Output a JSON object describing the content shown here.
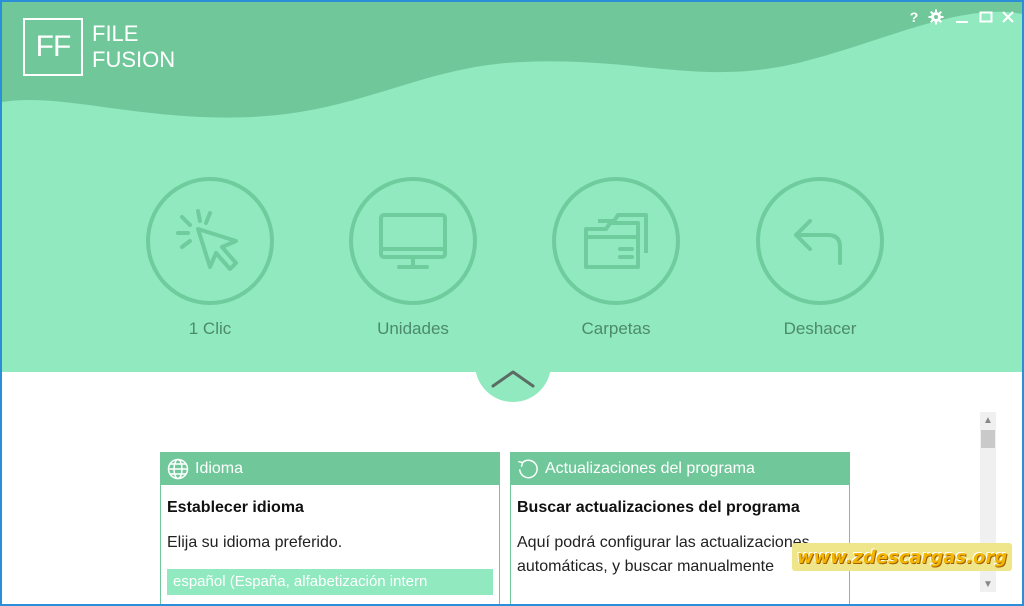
{
  "app": {
    "logo_mark": "FF",
    "logo_line1": "FILE",
    "logo_line2": "FUSION"
  },
  "window_controls": {
    "help": "?"
  },
  "actions": [
    {
      "label": "1 Clic",
      "icon": "cursor-click-icon"
    },
    {
      "label": "Unidades",
      "icon": "monitor-icon"
    },
    {
      "label": "Carpetas",
      "icon": "folders-icon"
    },
    {
      "label": "Deshacer",
      "icon": "undo-arrow-icon"
    }
  ],
  "panels": {
    "language": {
      "header": "Idioma",
      "title": "Establecer idioma",
      "description": "Elija su idioma preferido.",
      "selected": "español (España, alfabetización intern"
    },
    "updates": {
      "header": "Actualizaciones del programa",
      "title": "Buscar actualizaciones del programa",
      "description": "Aquí podrá configurar las actualizaciones automáticas, y buscar manualmente"
    }
  },
  "watermark": "www.zdescargas.org",
  "colors": {
    "hero_bg": "#90e9bf",
    "wave": "#70c89a",
    "accent": "#70c89a",
    "window_border": "#2a8fd8"
  }
}
